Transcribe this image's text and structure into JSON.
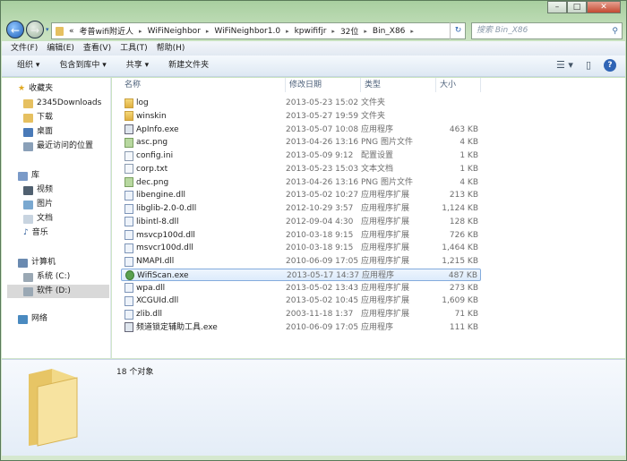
{
  "window": {
    "controls": [
      "minimize",
      "maximize",
      "close"
    ]
  },
  "address": {
    "crumbs": [
      "«",
      "考普wifi附近人",
      "WiFiNeighbor",
      "WiFiNeighbor1.0",
      "kpwififjr",
      "32位",
      "Bin_X86"
    ],
    "search_placeholder": "搜索 Bin_X86"
  },
  "menu": [
    "文件(F)",
    "编辑(E)",
    "查看(V)",
    "工具(T)",
    "帮助(H)"
  ],
  "toolbar": {
    "organize": "组织 ▾",
    "include": "包含到库中 ▾",
    "share": "共享 ▾",
    "new_folder": "新建文件夹"
  },
  "sidebar": {
    "favorites": "收藏夹",
    "fav_items": [
      "2345Downloads",
      "下载",
      "桌面",
      "最近访问的位置"
    ],
    "libraries": "库",
    "lib_items": [
      "视频",
      "图片",
      "文档",
      "音乐"
    ],
    "computer": "计算机",
    "drives": [
      "系统 (C:)",
      "软件 (D:)"
    ],
    "network": "网络"
  },
  "columns": {
    "name": "名称",
    "date": "修改日期",
    "type": "类型",
    "size": "大小"
  },
  "files": [
    {
      "name": "log",
      "date": "2013-05-23 15:02",
      "type": "文件夹",
      "size": "",
      "icon": "folder"
    },
    {
      "name": "winskin",
      "date": "2013-05-27 19:59",
      "type": "文件夹",
      "size": "",
      "icon": "folder"
    },
    {
      "name": "ApInfo.exe",
      "date": "2013-05-07 10:08",
      "type": "应用程序",
      "size": "463 KB",
      "icon": "exe"
    },
    {
      "name": "asc.png",
      "date": "2013-04-26 13:16",
      "type": "PNG 图片文件",
      "size": "4 KB",
      "icon": "png"
    },
    {
      "name": "config.ini",
      "date": "2013-05-09 9:12",
      "type": "配置设置",
      "size": "1 KB",
      "icon": "ini"
    },
    {
      "name": "corp.txt",
      "date": "2013-05-23 15:03",
      "type": "文本文档",
      "size": "1 KB",
      "icon": "txt"
    },
    {
      "name": "dec.png",
      "date": "2013-04-26 13:16",
      "type": "PNG 图片文件",
      "size": "4 KB",
      "icon": "png"
    },
    {
      "name": "libengine.dll",
      "date": "2013-05-02 10:27",
      "type": "应用程序扩展",
      "size": "213 KB",
      "icon": "dll"
    },
    {
      "name": "libglib-2.0-0.dll",
      "date": "2012-10-29 3:57",
      "type": "应用程序扩展",
      "size": "1,124 KB",
      "icon": "dll"
    },
    {
      "name": "libintl-8.dll",
      "date": "2012-09-04 4:30",
      "type": "应用程序扩展",
      "size": "128 KB",
      "icon": "dll"
    },
    {
      "name": "msvcp100d.dll",
      "date": "2010-03-18 9:15",
      "type": "应用程序扩展",
      "size": "726 KB",
      "icon": "dll"
    },
    {
      "name": "msvcr100d.dll",
      "date": "2010-03-18 9:15",
      "type": "应用程序扩展",
      "size": "1,464 KB",
      "icon": "dll"
    },
    {
      "name": "NMAPI.dll",
      "date": "2010-06-09 17:05",
      "type": "应用程序扩展",
      "size": "1,215 KB",
      "icon": "dll"
    },
    {
      "name": "WifiScan.exe",
      "date": "2013-05-17 14:37",
      "type": "应用程序",
      "size": "487 KB",
      "icon": "wifi",
      "selected": true
    },
    {
      "name": "wpa.dll",
      "date": "2013-05-02 13:43",
      "type": "应用程序扩展",
      "size": "273 KB",
      "icon": "dll"
    },
    {
      "name": "XCGUId.dll",
      "date": "2013-05-02 10:45",
      "type": "应用程序扩展",
      "size": "1,609 KB",
      "icon": "dll"
    },
    {
      "name": "zlib.dll",
      "date": "2003-11-18 1:37",
      "type": "应用程序扩展",
      "size": "71 KB",
      "icon": "dll"
    },
    {
      "name": "频道锁定辅助工具.exe",
      "date": "2010-06-09 17:05",
      "type": "应用程序",
      "size": "111 KB",
      "icon": "exe"
    }
  ],
  "status": {
    "count": "18 个对象"
  }
}
